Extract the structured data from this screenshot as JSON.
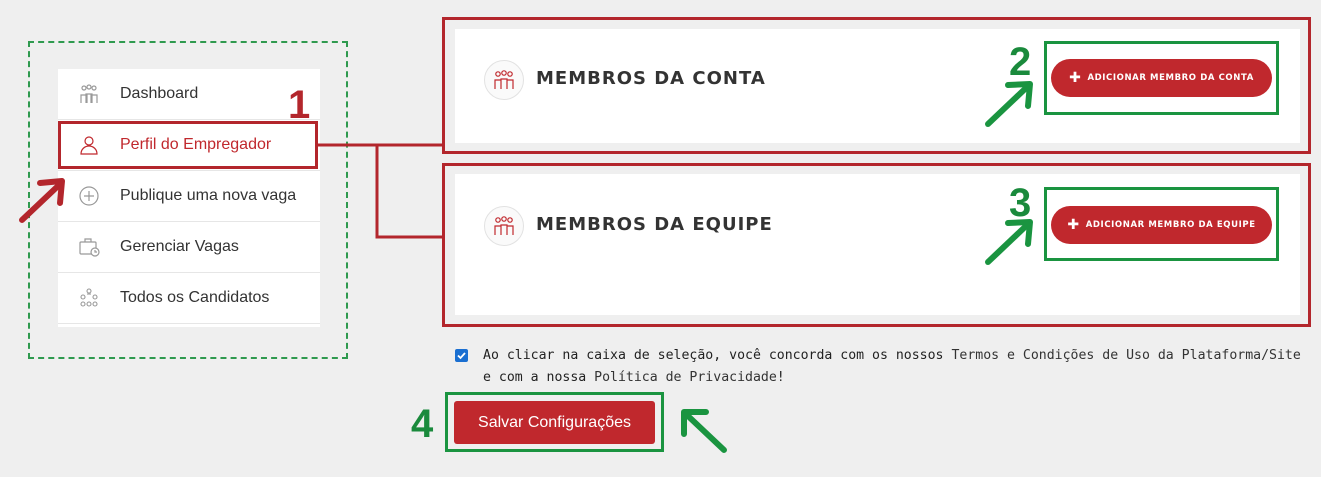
{
  "sidebar": {
    "items": [
      {
        "label": "Dashboard",
        "icon": "dashboard-people-icon"
      },
      {
        "label": "Perfil do Empregador",
        "icon": "user-icon",
        "active": true
      },
      {
        "label": "Publique uma nova vaga",
        "icon": "plus-circle-icon"
      },
      {
        "label": "Gerenciar Vagas",
        "icon": "briefcase-clock-icon"
      },
      {
        "label": "Todos os Candidatos",
        "icon": "group-icon"
      }
    ]
  },
  "account_members": {
    "title": "MEMBROS DA CONTA",
    "button_label": "ADICIONAR MEMBRO DA CONTA",
    "icon": "team-icon"
  },
  "team_members": {
    "title": "MEMBROS DA EQUIPE",
    "button_label": "ADICIONAR MEMBRO DA EQUIPE",
    "icon": "team-icon"
  },
  "consent": {
    "checked": true,
    "text_before": "Ao clicar na caixa de seleção, você concorda com os nossos ",
    "terms_link": "Termos e Condições de Uso da Plataforma/Site",
    "text_middle": " e com a nossa ",
    "privacy_link": "Política de Privacidade",
    "text_after": "!"
  },
  "save_button_label": "Salvar Configurações",
  "annotations": {
    "step1": "1",
    "step2": "2",
    "step3": "3",
    "step4": "4"
  },
  "colors": {
    "accent_red": "#c0282d",
    "annotation_red": "#b3262c",
    "annotation_green": "#1a9440",
    "background": "#efefef"
  }
}
